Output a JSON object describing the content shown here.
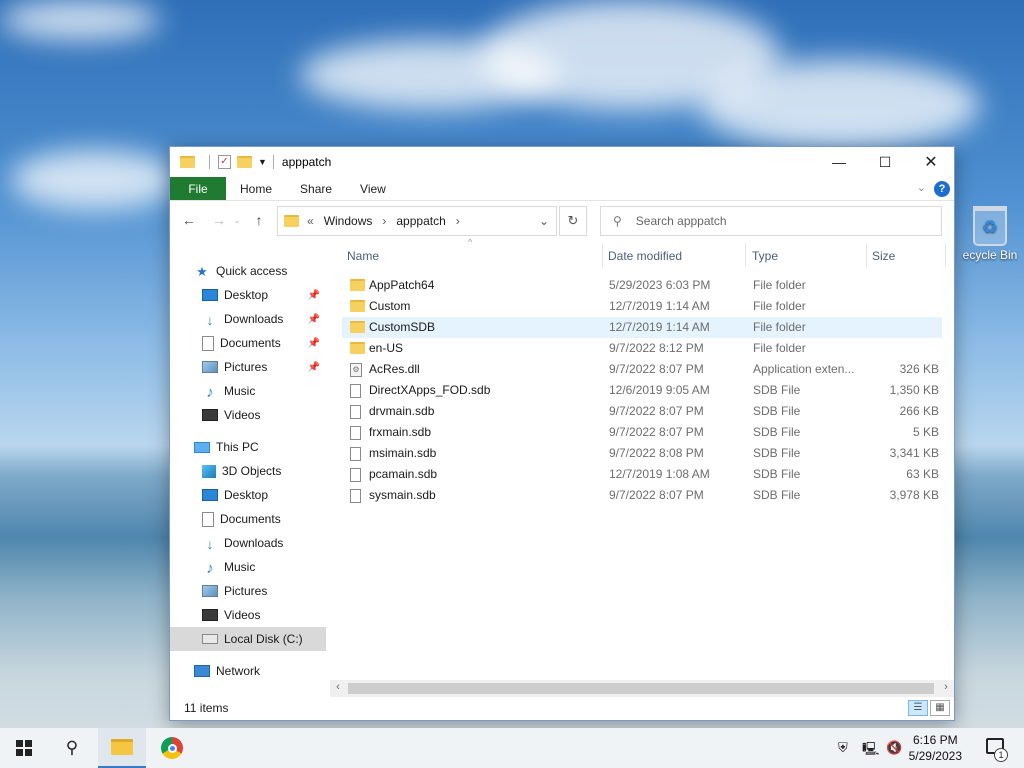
{
  "desktop": {
    "recycle_bin_label": "ecycle Bin"
  },
  "window": {
    "title": "apppatch",
    "ribbon_tabs": {
      "file": "File",
      "home": "Home",
      "share": "Share",
      "view": "View"
    },
    "address": {
      "prefix": "«",
      "segments": [
        "Windows",
        "apppatch"
      ]
    },
    "search_placeholder": "Search apppatch",
    "columns": {
      "name": "Name",
      "date": "Date modified",
      "type": "Type",
      "size": "Size"
    },
    "sidebar": {
      "quick_access": "Quick access",
      "quick_items": [
        "Desktop",
        "Downloads",
        "Documents",
        "Pictures",
        "Music",
        "Videos"
      ],
      "this_pc": "This PC",
      "pc_items": [
        "3D Objects",
        "Desktop",
        "Documents",
        "Downloads",
        "Music",
        "Pictures",
        "Videos",
        "Local Disk (C:)"
      ],
      "network": "Network"
    },
    "files": [
      {
        "name": "AppPatch64",
        "date": "5/29/2023 6:03 PM",
        "type": "File folder",
        "size": ""
      },
      {
        "name": "Custom",
        "date": "12/7/2019 1:14 AM",
        "type": "File folder",
        "size": ""
      },
      {
        "name": "CustomSDB",
        "date": "12/7/2019 1:14 AM",
        "type": "File folder",
        "size": ""
      },
      {
        "name": "en-US",
        "date": "9/7/2022 8:12 PM",
        "type": "File folder",
        "size": ""
      },
      {
        "name": "AcRes.dll",
        "date": "9/7/2022 8:07 PM",
        "type": "Application exten...",
        "size": "326 KB"
      },
      {
        "name": "DirectXApps_FOD.sdb",
        "date": "12/6/2019 9:05 AM",
        "type": "SDB File",
        "size": "1,350 KB"
      },
      {
        "name": "drvmain.sdb",
        "date": "9/7/2022 8:07 PM",
        "type": "SDB File",
        "size": "266 KB"
      },
      {
        "name": "frxmain.sdb",
        "date": "9/7/2022 8:07 PM",
        "type": "SDB File",
        "size": "5 KB"
      },
      {
        "name": "msimain.sdb",
        "date": "9/7/2022 8:08 PM",
        "type": "SDB File",
        "size": "3,341 KB"
      },
      {
        "name": "pcamain.sdb",
        "date": "12/7/2019 1:08 AM",
        "type": "SDB File",
        "size": "63 KB"
      },
      {
        "name": "sysmain.sdb",
        "date": "9/7/2022 8:07 PM",
        "type": "SDB File",
        "size": "3,978 KB"
      }
    ],
    "status": "11 items"
  },
  "taskbar": {
    "time": "6:16 PM",
    "date": "5/29/2023",
    "notification_count": "1"
  },
  "colors": {
    "file_tab": "#217a32",
    "selected_row": "#e5f3ff",
    "accent": "#1c6dd0"
  }
}
